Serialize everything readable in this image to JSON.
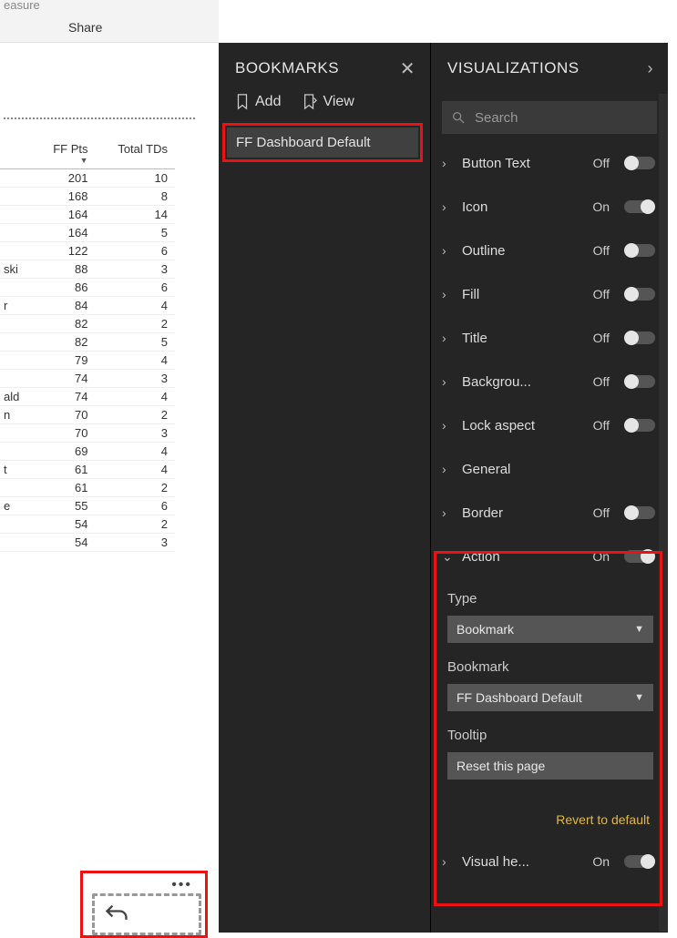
{
  "ribbon": {
    "cut_label": "easure",
    "share_label": "Share"
  },
  "panels": {
    "bookmarks": {
      "title": "BOOKMARKS",
      "add_label": "Add",
      "view_label": "View",
      "items": [
        {
          "label": "FF Dashboard Default"
        }
      ]
    },
    "visualizations": {
      "title": "VISUALIZATIONS",
      "search_placeholder": "Search",
      "properties": [
        {
          "label": "Button Text",
          "state": "Off",
          "on": false,
          "has_toggle": true
        },
        {
          "label": "Icon",
          "state": "On",
          "on": true,
          "has_toggle": true
        },
        {
          "label": "Outline",
          "state": "Off",
          "on": false,
          "has_toggle": true
        },
        {
          "label": "Fill",
          "state": "Off",
          "on": false,
          "has_toggle": true
        },
        {
          "label": "Title",
          "state": "Off",
          "on": false,
          "has_toggle": true
        },
        {
          "label": "Backgrou...",
          "state": "Off",
          "on": false,
          "has_toggle": true
        },
        {
          "label": "Lock aspect",
          "state": "Off",
          "on": false,
          "has_toggle": true
        },
        {
          "label": "General",
          "state": "",
          "on": false,
          "has_toggle": false
        },
        {
          "label": "Border",
          "state": "Off",
          "on": false,
          "has_toggle": true
        }
      ],
      "action": {
        "label": "Action",
        "state": "On",
        "on": true,
        "type_label": "Type",
        "type_value": "Bookmark",
        "bookmark_label": "Bookmark",
        "bookmark_value": "FF Dashboard Default",
        "tooltip_label": "Tooltip",
        "tooltip_value": "Reset this page",
        "revert_label": "Revert to default"
      },
      "footer_prop": {
        "label": "Visual he...",
        "state": "On",
        "on": true
      }
    }
  },
  "table": {
    "headers": [
      "",
      "FF Pts",
      "Total TDs"
    ],
    "rows": [
      [
        "",
        "201",
        "10"
      ],
      [
        "",
        "168",
        "8"
      ],
      [
        "",
        "164",
        "14"
      ],
      [
        "",
        "164",
        "5"
      ],
      [
        "",
        "122",
        "6"
      ],
      [
        "ski",
        "88",
        "3"
      ],
      [
        "",
        "86",
        "6"
      ],
      [
        "r",
        "84",
        "4"
      ],
      [
        "",
        "82",
        "2"
      ],
      [
        "",
        "82",
        "5"
      ],
      [
        "",
        "79",
        "4"
      ],
      [
        "",
        "74",
        "3"
      ],
      [
        "ald",
        "74",
        "4"
      ],
      [
        "n",
        "70",
        "2"
      ],
      [
        "",
        "70",
        "3"
      ],
      [
        "",
        "69",
        "4"
      ],
      [
        "t",
        "61",
        "4"
      ],
      [
        "",
        "61",
        "2"
      ],
      [
        "e",
        "55",
        "6"
      ],
      [
        "",
        "54",
        "2"
      ],
      [
        "",
        "54",
        "3"
      ]
    ]
  }
}
